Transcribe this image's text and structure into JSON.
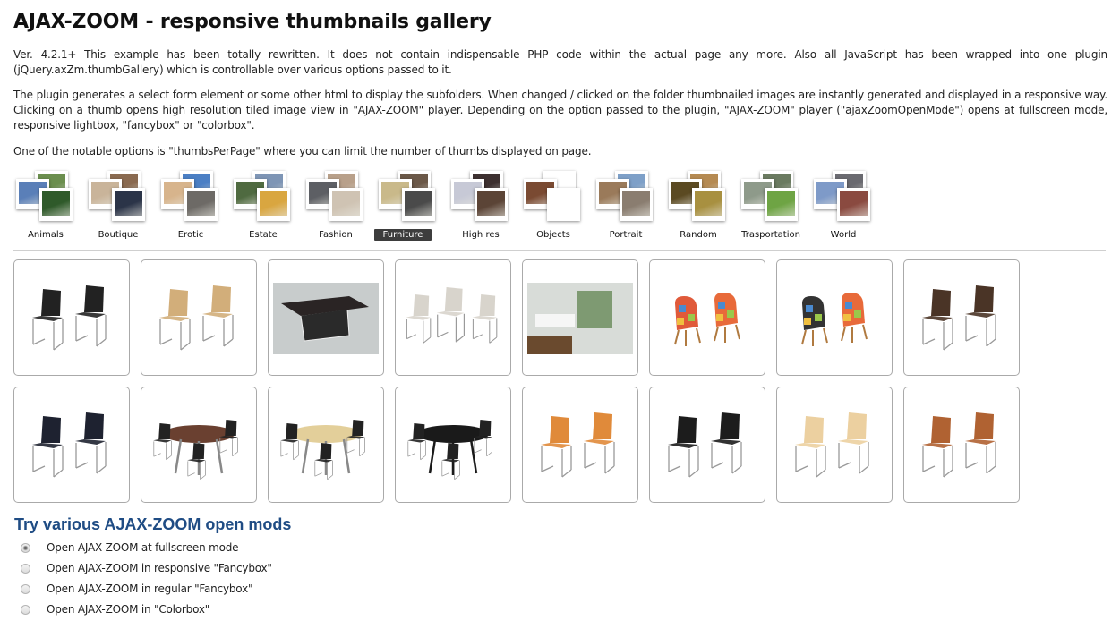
{
  "page": {
    "title": "AJAX-ZOOM - responsive thumbnails gallery",
    "paragraphs": [
      "Ver. 4.2.1+ This example has been totally rewritten. It does not contain indispensable PHP code within the actual page any more. Also all JavaScript has been wrapped into one plugin (jQuery.axZm.thumbGallery) which is controllable over various options passed to it.",
      "The plugin generates a select form element or some other html to display the subfolders. When changed / clicked on the folder thumbnailed images are instantly generated and displayed in a responsive way. Clicking on a thumb opens high resolution tiled image view in \"AJAX-ZOOM\" player. Depending on the option passed to the plugin, \"AJAX-ZOOM\" player (\"ajaxZoomOpenMode\") opens at fullscreen mode, responsive lightbox, \"fancybox\" or \"colorbox\".",
      "One of the notable options is \"thumbsPerPage\" where you can limit the number of thumbs displayed on page."
    ]
  },
  "folders": {
    "active": "Furniture",
    "items": [
      {
        "label": "Animals",
        "colors": [
          "#6b8e4e",
          "#5a7fb8",
          "#2f5a2a"
        ]
      },
      {
        "label": "Boutique",
        "colors": [
          "#8a6a50",
          "#c9b49a",
          "#2b3448"
        ]
      },
      {
        "label": "Erotic",
        "colors": [
          "#4b7fc4",
          "#d7b48c",
          "#6d6a66"
        ]
      },
      {
        "label": "Estate",
        "colors": [
          "#7e95b5",
          "#4f6a40",
          "#d9a640"
        ]
      },
      {
        "label": "Fashion",
        "colors": [
          "#b8a08a",
          "#5d5f64",
          "#cfc3b3"
        ]
      },
      {
        "label": "Furniture",
        "colors": [
          "#6b5848",
          "#c9b98a",
          "#4a4a4a"
        ]
      },
      {
        "label": "High res",
        "colors": [
          "#3d3030",
          "#c7c9d6",
          "#5b4436"
        ]
      },
      {
        "label": "Objects",
        "colors": [
          "#ffffff",
          "#7a4a32",
          "#ffffff"
        ]
      },
      {
        "label": "Portrait",
        "colors": [
          "#7ea0c8",
          "#9a7a5a",
          "#8a7d70"
        ]
      },
      {
        "label": "Random",
        "colors": [
          "#b58a52",
          "#5b4a22",
          "#a89040"
        ]
      },
      {
        "label": "Trasportation",
        "colors": [
          "#6a7a60",
          "#8e9a8a",
          "#6ea444"
        ]
      },
      {
        "label": "World",
        "colors": [
          "#6a6a70",
          "#7e9ac8",
          "#8a4a40"
        ]
      }
    ]
  },
  "gallery": {
    "rows": [
      [
        {
          "name": "black-woven-chairs",
          "kind": "chairs-pair",
          "color": "#222222"
        },
        {
          "name": "tan-woven-chairs",
          "kind": "chairs-pair",
          "color": "#d2ae7a"
        },
        {
          "name": "dark-coffee-table",
          "kind": "photo-table",
          "color": "#2a2424"
        },
        {
          "name": "louis-chairs",
          "kind": "chairs-trio",
          "color": "#d8d4cc"
        },
        {
          "name": "living-room",
          "kind": "photo-room",
          "color": "#d8dcd8"
        },
        {
          "name": "patchwork-armchairs",
          "kind": "armchairs",
          "color": "#e05a3a"
        },
        {
          "name": "patchwork-bw-armchairs",
          "kind": "armchairs",
          "color": "#333333"
        },
        {
          "name": "leather-armchairs",
          "kind": "chairs-pair",
          "color": "#4a3426"
        }
      ],
      [
        {
          "name": "cantilever-chairs",
          "kind": "chairs-pair",
          "color": "#1e2230"
        },
        {
          "name": "round-table-set",
          "kind": "dining",
          "color": "#6a4030"
        },
        {
          "name": "light-table-set",
          "kind": "dining",
          "color": "#e3cf9a"
        },
        {
          "name": "black-table-set",
          "kind": "dining",
          "color": "#1a1a1a"
        },
        {
          "name": "orange-chairs",
          "kind": "chairs-pair",
          "color": "#e08a3a"
        },
        {
          "name": "black-chairs",
          "kind": "chairs-pair",
          "color": "#1c1c1c"
        },
        {
          "name": "cream-chairs",
          "kind": "chairs-pair",
          "color": "#ecd0a0"
        },
        {
          "name": "brown-woven-chairs",
          "kind": "chairs-pair",
          "color": "#b06232"
        }
      ]
    ]
  },
  "open_modes": {
    "heading": "Try various AJAX-ZOOM open mods",
    "selected_index": 0,
    "options": [
      "Open AJAX-ZOOM at fullscreen mode",
      "Open AJAX-ZOOM in responsive \"Fancybox\"",
      "Open AJAX-ZOOM in regular \"Fancybox\"",
      "Open AJAX-ZOOM in \"Colorbox\""
    ]
  }
}
